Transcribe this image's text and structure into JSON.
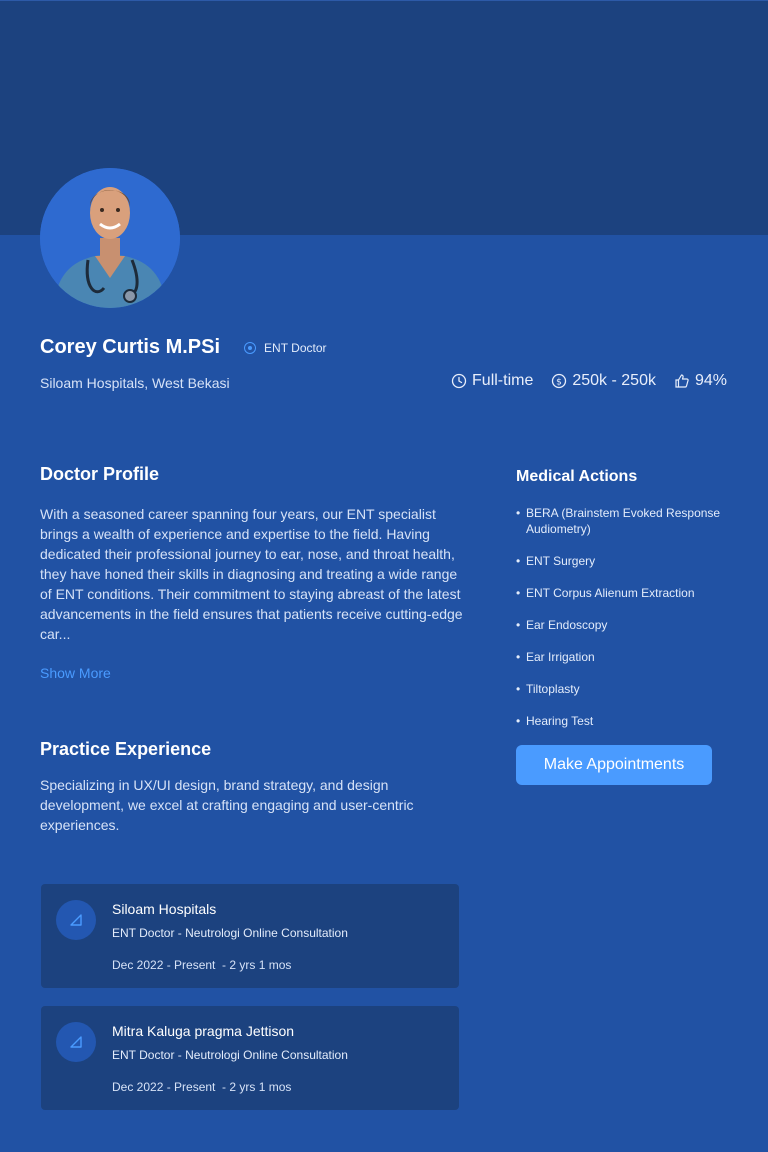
{
  "doctor": {
    "name": "Corey Curtis M.PSi",
    "role": "ENT Doctor",
    "location": "Siloam Hospitals, West Bekasi"
  },
  "stats": {
    "employment": "Full-time",
    "fee": "250k - 250k",
    "rating": "94%"
  },
  "profile": {
    "title": "Doctor Profile",
    "text": "With a seasoned career spanning four years, our ENT specialist brings a wealth of experience and expertise to the field. Having dedicated their professional journey to ear, nose, and throat health, they have honed their skills in diagnosing and treating a wide range of ENT conditions. Their commitment to staying abreast of the latest advancements in the field ensures that patients receive cutting-edge car...",
    "show_more": "Show More"
  },
  "experience": {
    "title": "Practice Experience",
    "text": "Specializing in UX/UI design, brand strategy, and design development, we excel at crafting engaging and user-centric experiences.",
    "items": [
      {
        "title": "Siloam Hospitals",
        "subtitle": "ENT Doctor - Neutrologi Online Consultation",
        "period": "Dec 2022 - Present  - 2 yrs 1 mos"
      },
      {
        "title": "Mitra Kaluga pragma Jettison",
        "subtitle": "ENT Doctor - Neutrologi Online Consultation",
        "period": "Dec 2022 - Present  - 2 yrs 1 mos"
      }
    ]
  },
  "medical_actions": {
    "title": "Medical Actions",
    "items": [
      "BERA (Brainstem Evoked Response Audiometry)",
      "ENT Surgery",
      "ENT Corpus Alienum Extraction",
      "Ear Endoscopy",
      "Ear Irrigation",
      "Tiltoplasty",
      "Hearing Test"
    ],
    "button": "Make Appointments"
  },
  "icons": {
    "role": "target-icon",
    "employment": "clock-icon",
    "fee": "dollar-circle-icon",
    "rating": "thumbs-up-icon",
    "card_logo": "triangle-logo-icon"
  },
  "colors": {
    "background": "#2152a4",
    "cover": "#1c427f",
    "card": "#1c427f",
    "accent": "#4a9bff"
  }
}
